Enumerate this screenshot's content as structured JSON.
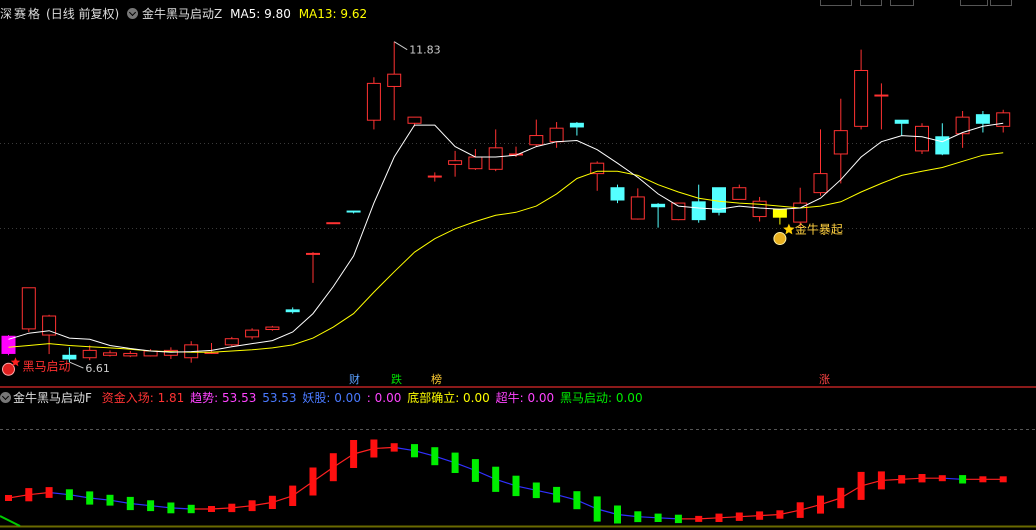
{
  "header": {
    "stock_name": "深赛格",
    "period": "(日线 前复权)",
    "indicator_name": "金牛黑马启动Z",
    "ma5_label": "MA5: 9.80",
    "ma13_label": "MA13: 9.62",
    "colors": {
      "ma5": "#ffffff",
      "ma13": "#ffff00"
    }
  },
  "annotations": {
    "high_label": "11.83",
    "low_label": "6.61",
    "signal_left": "黑马启动",
    "signal_right": "金牛暴起"
  },
  "event_tags": [
    {
      "text": "财",
      "color": "#5aa0ff"
    },
    {
      "text": "跌",
      "color": "#00e000"
    },
    {
      "text": "榜",
      "color": "#ffcc33"
    },
    {
      "text": "涨",
      "color": "#ff4444"
    }
  ],
  "lower_header": {
    "indicator_name": "金牛黑马启动F",
    "items": [
      {
        "label": "资金入场: 1.81",
        "color": "#ff3333"
      },
      {
        "label": "趋势: 53.53",
        "color": "#ff44ff"
      },
      {
        "label": "53.53",
        "color": "#4a7aff"
      },
      {
        "label": "妖股: 0.00",
        "color": "#4a7aff"
      },
      {
        "label": ": 0.00",
        "color": "#ff44ff"
      },
      {
        "label": "底部确立: 0.00",
        "color": "#ffff00"
      },
      {
        "label": "超牛: 0.00",
        "color": "#ff44ff"
      },
      {
        "label": "黑马启动: 0.00",
        "color": "#00ee00"
      }
    ]
  },
  "chart_data": [
    {
      "type": "candlestick",
      "x": [
        1,
        2,
        3,
        4,
        5,
        6,
        7,
        8,
        9,
        10,
        11,
        12,
        13,
        14,
        15,
        16,
        17,
        18,
        19,
        20,
        21,
        22,
        23,
        24,
        25,
        26,
        27,
        28,
        29,
        30,
        31,
        32,
        33,
        34,
        35,
        36,
        37,
        38,
        39,
        40,
        41,
        42,
        43,
        44,
        45,
        46,
        47,
        48,
        49,
        50
      ],
      "open": [
        6.75,
        7.15,
        7.05,
        6.72,
        6.68,
        6.72,
        6.71,
        6.71,
        6.72,
        6.68,
        6.75,
        6.89,
        7.02,
        7.14,
        7.46,
        8.38,
        8.88,
        9.07,
        10.55,
        11.1,
        10.5,
        9.64,
        9.83,
        9.76,
        9.75,
        10.0,
        10.15,
        10.2,
        10.5,
        9.68,
        9.45,
        8.94,
        9.18,
        8.93,
        9.22,
        9.45,
        9.26,
        8.98,
        9.1,
        8.89,
        9.37,
        10.0,
        10.45,
        10.96,
        10.55,
        10.05,
        10.28,
        10.33,
        10.64,
        10.45
      ],
      "close": [
        7.03,
        7.82,
        7.36,
        6.66,
        6.8,
        6.76,
        6.75,
        6.79,
        6.8,
        6.89,
        6.77,
        6.99,
        7.13,
        7.18,
        7.43,
        8.38,
        8.88,
        9.06,
        11.15,
        11.3,
        10.6,
        9.64,
        9.89,
        9.95,
        10.1,
        10.0,
        10.3,
        10.42,
        10.44,
        9.85,
        9.25,
        9.3,
        9.14,
        9.2,
        8.93,
        9.05,
        9.45,
        9.23,
        8.97,
        9.2,
        9.68,
        10.38,
        11.36,
        10.96,
        10.5,
        10.45,
        10.0,
        10.6,
        10.5,
        10.67
      ],
      "high": [
        7.05,
        7.82,
        7.38,
        6.85,
        6.88,
        6.8,
        6.79,
        6.82,
        6.85,
        6.95,
        6.92,
        7.02,
        7.16,
        7.2,
        7.5,
        8.4,
        8.88,
        9.06,
        11.25,
        11.83,
        10.6,
        9.7,
        10.05,
        10.08,
        10.4,
        10.12,
        10.56,
        10.52,
        10.52,
        9.88,
        9.5,
        9.44,
        9.2,
        9.2,
        9.5,
        9.08,
        9.5,
        9.3,
        9.08,
        9.45,
        10.4,
        10.9,
        11.7,
        11.15,
        10.55,
        10.5,
        10.5,
        10.7,
        10.7,
        10.72
      ],
      "low": [
        6.72,
        7.1,
        6.74,
        6.61,
        6.64,
        6.7,
        6.69,
        6.7,
        6.66,
        6.6,
        6.74,
        6.87,
        6.98,
        7.12,
        7.4,
        7.9,
        8.86,
        9.03,
        10.4,
        10.55,
        10.45,
        9.55,
        9.63,
        9.74,
        9.72,
        9.95,
        10.12,
        10.1,
        10.3,
        9.4,
        9.2,
        8.93,
        8.8,
        8.92,
        8.88,
        9.0,
        9.26,
        8.9,
        8.85,
        8.8,
        9.32,
        9.52,
        10.4,
        10.4,
        10.3,
        10.0,
        9.98,
        10.1,
        10.35,
        10.35
      ],
      "ma5": [
        6.98,
        7.08,
        7.12,
        7.0,
        6.98,
        6.88,
        6.83,
        6.79,
        6.77,
        6.78,
        6.8,
        6.86,
        6.91,
        6.96,
        7.1,
        7.4,
        7.84,
        8.34,
        9.2,
        9.95,
        10.47,
        10.47,
        10.12,
        9.95,
        9.95,
        9.98,
        10.12,
        10.2,
        10.22,
        10.07,
        9.85,
        9.62,
        9.35,
        9.15,
        9.12,
        9.1,
        9.15,
        9.12,
        9.1,
        9.12,
        9.28,
        9.58,
        9.95,
        10.2,
        10.3,
        10.28,
        10.2,
        10.35,
        10.45,
        10.5
      ],
      "ma13": [
        6.85,
        6.88,
        6.91,
        6.88,
        6.86,
        6.84,
        6.82,
        6.79,
        6.78,
        6.77,
        6.77,
        6.79,
        6.81,
        6.84,
        6.89,
        7.0,
        7.18,
        7.4,
        7.75,
        8.08,
        8.4,
        8.62,
        8.78,
        8.9,
        9.0,
        9.05,
        9.15,
        9.35,
        9.6,
        9.72,
        9.72,
        9.65,
        9.5,
        9.38,
        9.28,
        9.23,
        9.2,
        9.18,
        9.15,
        9.12,
        9.15,
        9.22,
        9.38,
        9.52,
        9.65,
        9.72,
        9.78,
        9.88,
        9.98,
        10.02
      ]
    },
    {
      "type": "line",
      "series": [
        {
          "name": "趋势",
          "values": [
            20,
            23,
            25,
            23,
            20,
            18,
            15,
            13,
            11,
            10,
            10,
            11,
            13,
            16,
            22,
            35,
            48,
            60,
            65,
            66,
            63,
            58,
            52,
            45,
            37,
            31,
            27,
            23,
            18,
            10,
            5,
            3,
            2,
            1,
            1,
            2,
            3,
            4,
            5,
            9,
            14,
            20,
            31,
            36,
            37,
            38,
            38,
            37,
            37,
            37
          ]
        }
      ],
      "ylim": [
        0,
        100
      ]
    }
  ]
}
